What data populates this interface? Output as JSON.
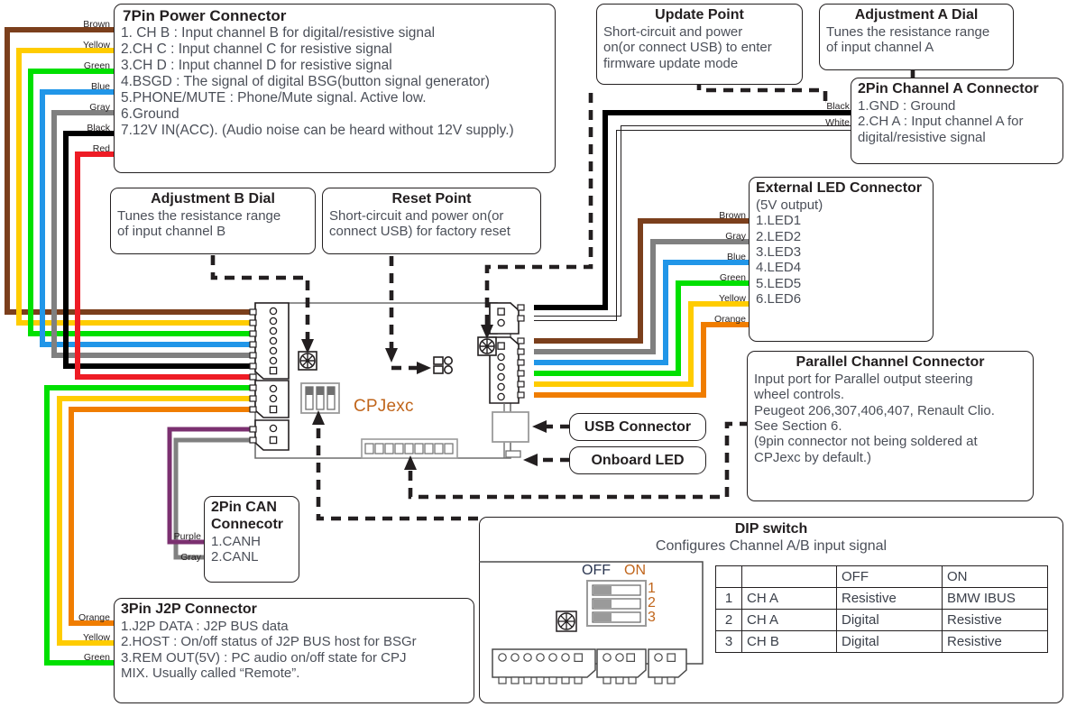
{
  "diagram": {
    "board_label": "CPJexc"
  },
  "boxes": {
    "power7pin": {
      "title": "7Pin Power Connector",
      "lines": [
        "1. CH B : Input channel B for digital/resistive signal",
        "2.CH C : Input channel C for resistive signal",
        "3.CH D : Input channel D for resistive signal",
        "4.BSGD : The signal of digital BSG(button signal generator)",
        "5.PHONE/MUTE : Phone/Mute signal. Active low.",
        "6.Ground",
        "7.12V IN(ACC). (Audio noise can be heard without 12V supply.)"
      ]
    },
    "update_point": {
      "title": "Update Point",
      "lines": [
        "Short-circuit and power",
        "on(or connect USB) to enter",
        "firmware update mode"
      ]
    },
    "adjust_a": {
      "title": "Adjustment A Dial",
      "lines": [
        "Tunes the resistance range",
        "of input channel A"
      ]
    },
    "chan_a_2pin": {
      "title": "2Pin Channel A Connector",
      "lines": [
        "1.GND : Ground",
        "2.CH A : Input channel A for",
        "digital/resistive signal"
      ]
    },
    "adjust_b": {
      "title": "Adjustment B Dial",
      "lines": [
        "Tunes the resistance range",
        "of input channel B"
      ]
    },
    "reset_point": {
      "title": "Reset Point",
      "lines": [
        "Short-circuit and power on(or",
        "connect USB) for factory reset"
      ]
    },
    "ext_led": {
      "title": "External LED Connector",
      "lines": [
        "(5V output)",
        "1.LED1",
        "2.LED2",
        "3.LED3",
        "4.LED4",
        "5.LED5",
        "6.LED6"
      ]
    },
    "parallel": {
      "title": "Parallel Channel Connector",
      "lines": [
        "Input port for Parallel output steering",
        "wheel controls.",
        "Peugeot 206,307,406,407, Renault Clio.",
        "See Section 6.",
        "(9pin connector not being soldered at",
        "CPJexc by default.)"
      ]
    },
    "can2pin": {
      "title_lines": [
        "2Pin CAN",
        "Connecotr"
      ],
      "lines": [
        "1.CANH",
        "2.CANL"
      ]
    },
    "j2p3pin": {
      "title": "3Pin J2P Connector",
      "lines": [
        "1.J2P DATA : J2P BUS data",
        "2.HOST : On/off  status of J2P BUS host for BSGr",
        "3.REM OUT(5V) : PC audio on/off state for CPJ",
        "MIX. Usually called “Remote”."
      ]
    },
    "usb": {
      "label": "USB Connector"
    },
    "onboard_led": {
      "label": "Onboard LED"
    },
    "dip": {
      "title": "DIP switch",
      "subtitle": "Configures Channel A/B input signal",
      "off_label": "OFF",
      "on_label": "ON",
      "switch_numbers": [
        "1",
        "2",
        "3"
      ],
      "table": {
        "header": [
          "",
          "",
          "OFF",
          "ON"
        ],
        "rows": [
          [
            "1",
            "CH A",
            "Resistive",
            "BMW IBUS"
          ],
          [
            "2",
            "CH A",
            "Digital",
            "Resistive"
          ],
          [
            "3",
            "CH B",
            "Digital",
            "Resistive"
          ]
        ]
      }
    }
  },
  "wire_labels": {
    "left_top": [
      "Brown",
      "Yellow",
      "Green",
      "Blue",
      "Gray",
      "Black",
      "Red"
    ],
    "left_bottom": [
      "Orange",
      "Yellow",
      "Green"
    ],
    "can": [
      "Purple",
      "Gray"
    ],
    "right_top": [
      "Black",
      "White"
    ],
    "right_led": [
      "Brown",
      "Gray",
      "Blue",
      "Green",
      "Yellow",
      "Orange"
    ]
  },
  "colors": {
    "brown": "#7B3F1C",
    "yellow": "#FFCC00",
    "green": "#00E000",
    "blue": "#2196E8",
    "gray": "#808080",
    "black": "#000000",
    "red": "#EE1C25",
    "orange": "#F07D00",
    "purple": "#7B3070",
    "white": "#FFFFFF",
    "accent": "#C0651B",
    "ink": "#231f20",
    "body_text": "#4b4f58"
  }
}
